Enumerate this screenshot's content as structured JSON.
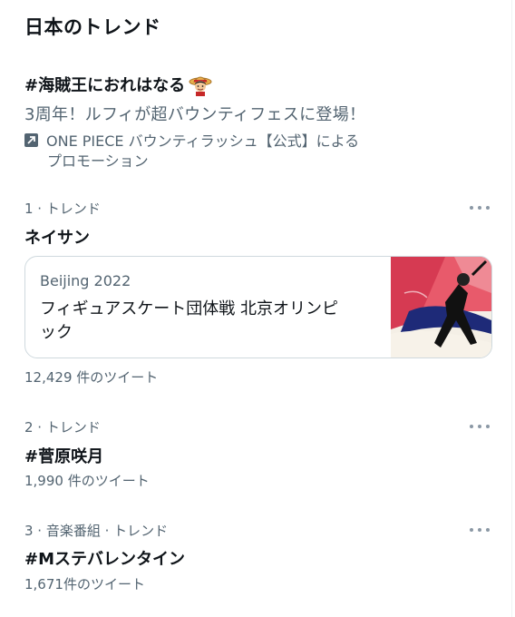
{
  "header": {
    "title": "日本のトレンド"
  },
  "promoted": {
    "hashtag": "#海賊王におれはなる",
    "description": "3周年！ルフィが超バウンティフェスに登場！",
    "promoter_line1": "ONE PIECE バウンティラッシュ【公式】による",
    "promoter_line2": "プロモーション",
    "emoji_icon": "luffy-emoji",
    "promo_icon": "promoted-arrow-icon"
  },
  "trends": [
    {
      "meta": "1 · トレンド",
      "name": "ネイサン",
      "count": "12,429 件のツイート",
      "card": {
        "source": "Beijing 2022",
        "title": "フィギュアスケート団体戦 北京オリンピック"
      }
    },
    {
      "meta": "2 · トレンド",
      "name": "#菅原咲月",
      "count": "1,990 件のツイート"
    },
    {
      "meta": "3 · 音楽番組 · トレンド",
      "name": "#Mステバレンタイン",
      "count": "1,671件のツイート"
    }
  ],
  "colors": {
    "text_primary": "#0f1419",
    "text_secondary": "#536471",
    "border": "#cfd9de"
  }
}
